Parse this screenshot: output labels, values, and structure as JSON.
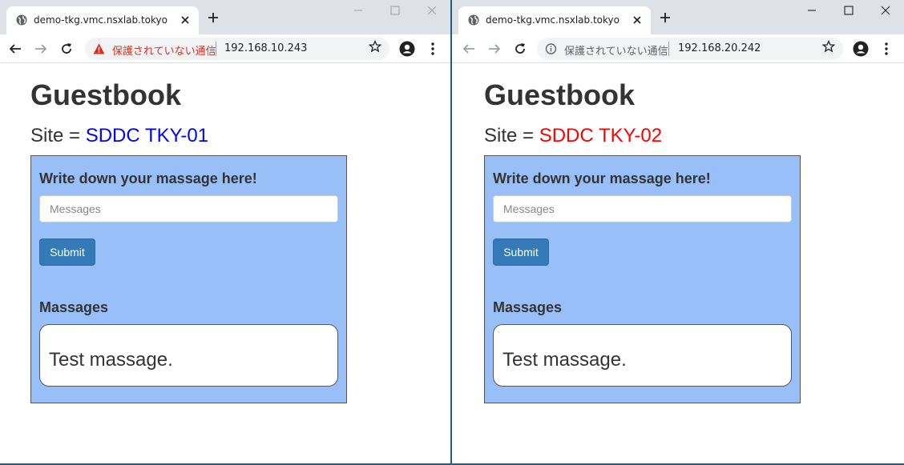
{
  "windows": [
    {
      "tab_title": "demo-tkg.vmc.nsxlab.tokyo",
      "security_label": "保護されていない通信",
      "security_color": "#d93025",
      "security_icon": "warning-triangle-icon",
      "url": "192.168.10.243",
      "page": {
        "title": "Guestbook",
        "site_prefix": "Site = ",
        "site_name": "SDDC TKY-01",
        "site_color": "#0000ff",
        "form_heading": "Write down your massage here!",
        "input_placeholder": "Messages",
        "submit_label": "Submit",
        "messages_heading": "Massages",
        "messages": [
          "Test massage."
        ]
      }
    },
    {
      "tab_title": "demo-tkg.vmc.nsxlab.tokyo",
      "security_label": "保護されていない通信",
      "security_color": "#5f6368",
      "security_icon": "info-icon",
      "url": "192.168.20.242",
      "page": {
        "title": "Guestbook",
        "site_prefix": "Site = ",
        "site_name": "SDDC TKY-02",
        "site_color": "#ff0000",
        "form_heading": "Write down your massage here!",
        "input_placeholder": "Messages",
        "submit_label": "Submit",
        "messages_heading": "Massages",
        "messages": [
          "Test massage."
        ]
      }
    }
  ],
  "colors": {
    "panel_bg": "#99bff9",
    "button_bg": "#337ab7",
    "titlebar_bg": "#dee1e6"
  }
}
